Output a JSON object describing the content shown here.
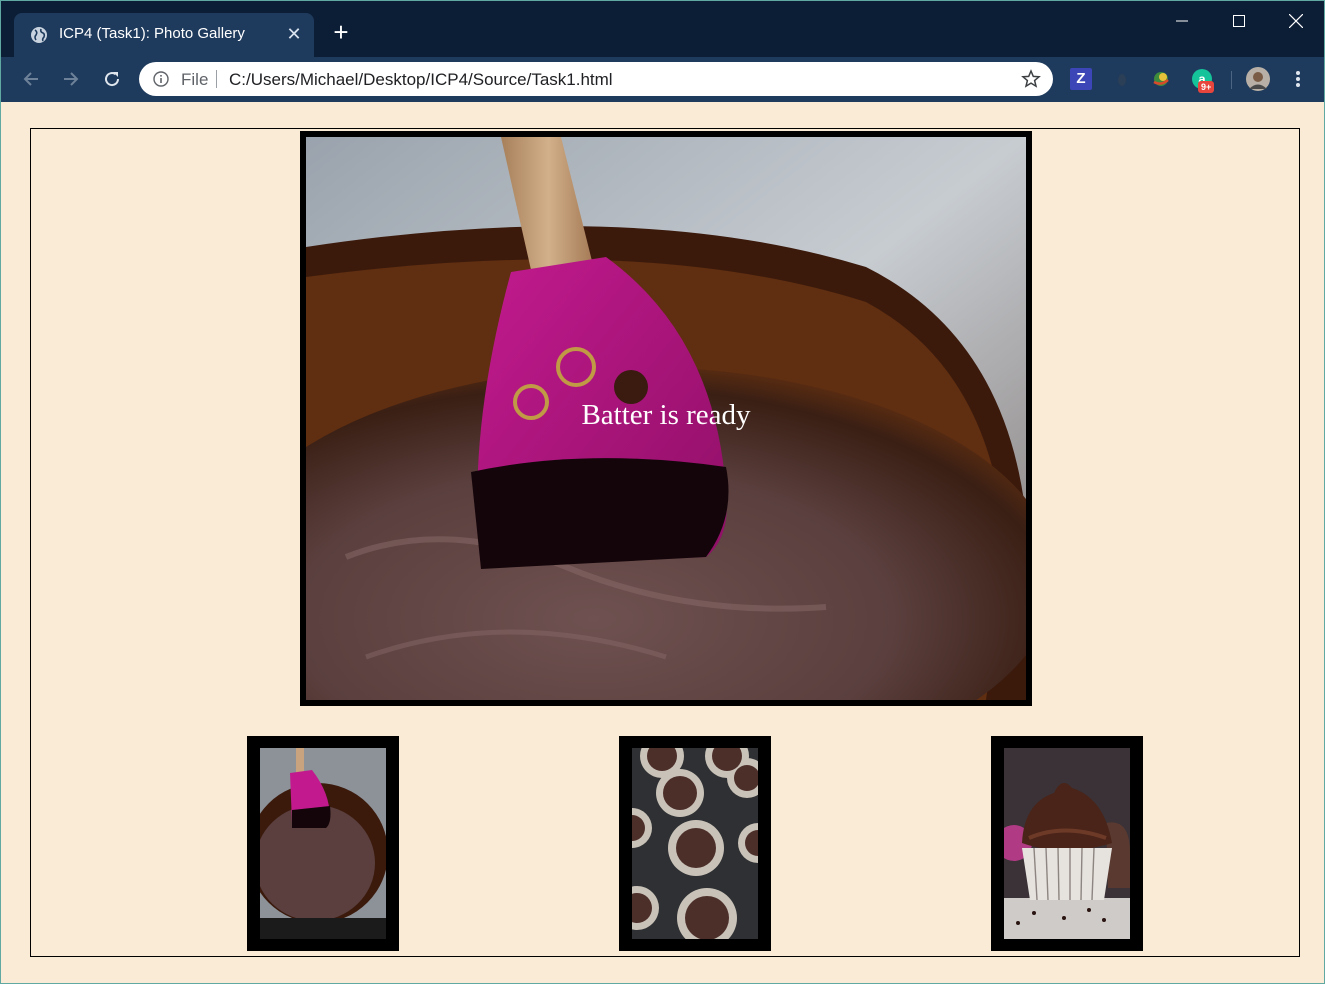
{
  "browser": {
    "tab_title": "ICP4 (Task1): Photo Gallery",
    "tab_close": "✕",
    "new_tab": "+",
    "address_prefix": "File",
    "url": "C:/Users/Michael/Desktop/ICP4/Source/Task1.html",
    "extension_z_label": "Z",
    "notification_badge": "9+"
  },
  "gallery": {
    "preview_caption": "Batter is ready",
    "thumbnails": [
      {
        "subject": "spatula in chocolate batter bowl"
      },
      {
        "subject": "batter in cupcake liners in muffin tin"
      },
      {
        "subject": "chocolate frosted cupcake"
      }
    ]
  },
  "colors": {
    "page_background": "#faebd7",
    "tab_strip": "#0c1e36",
    "toolbar": "#1e3a5c",
    "frame_border": "#000000"
  }
}
